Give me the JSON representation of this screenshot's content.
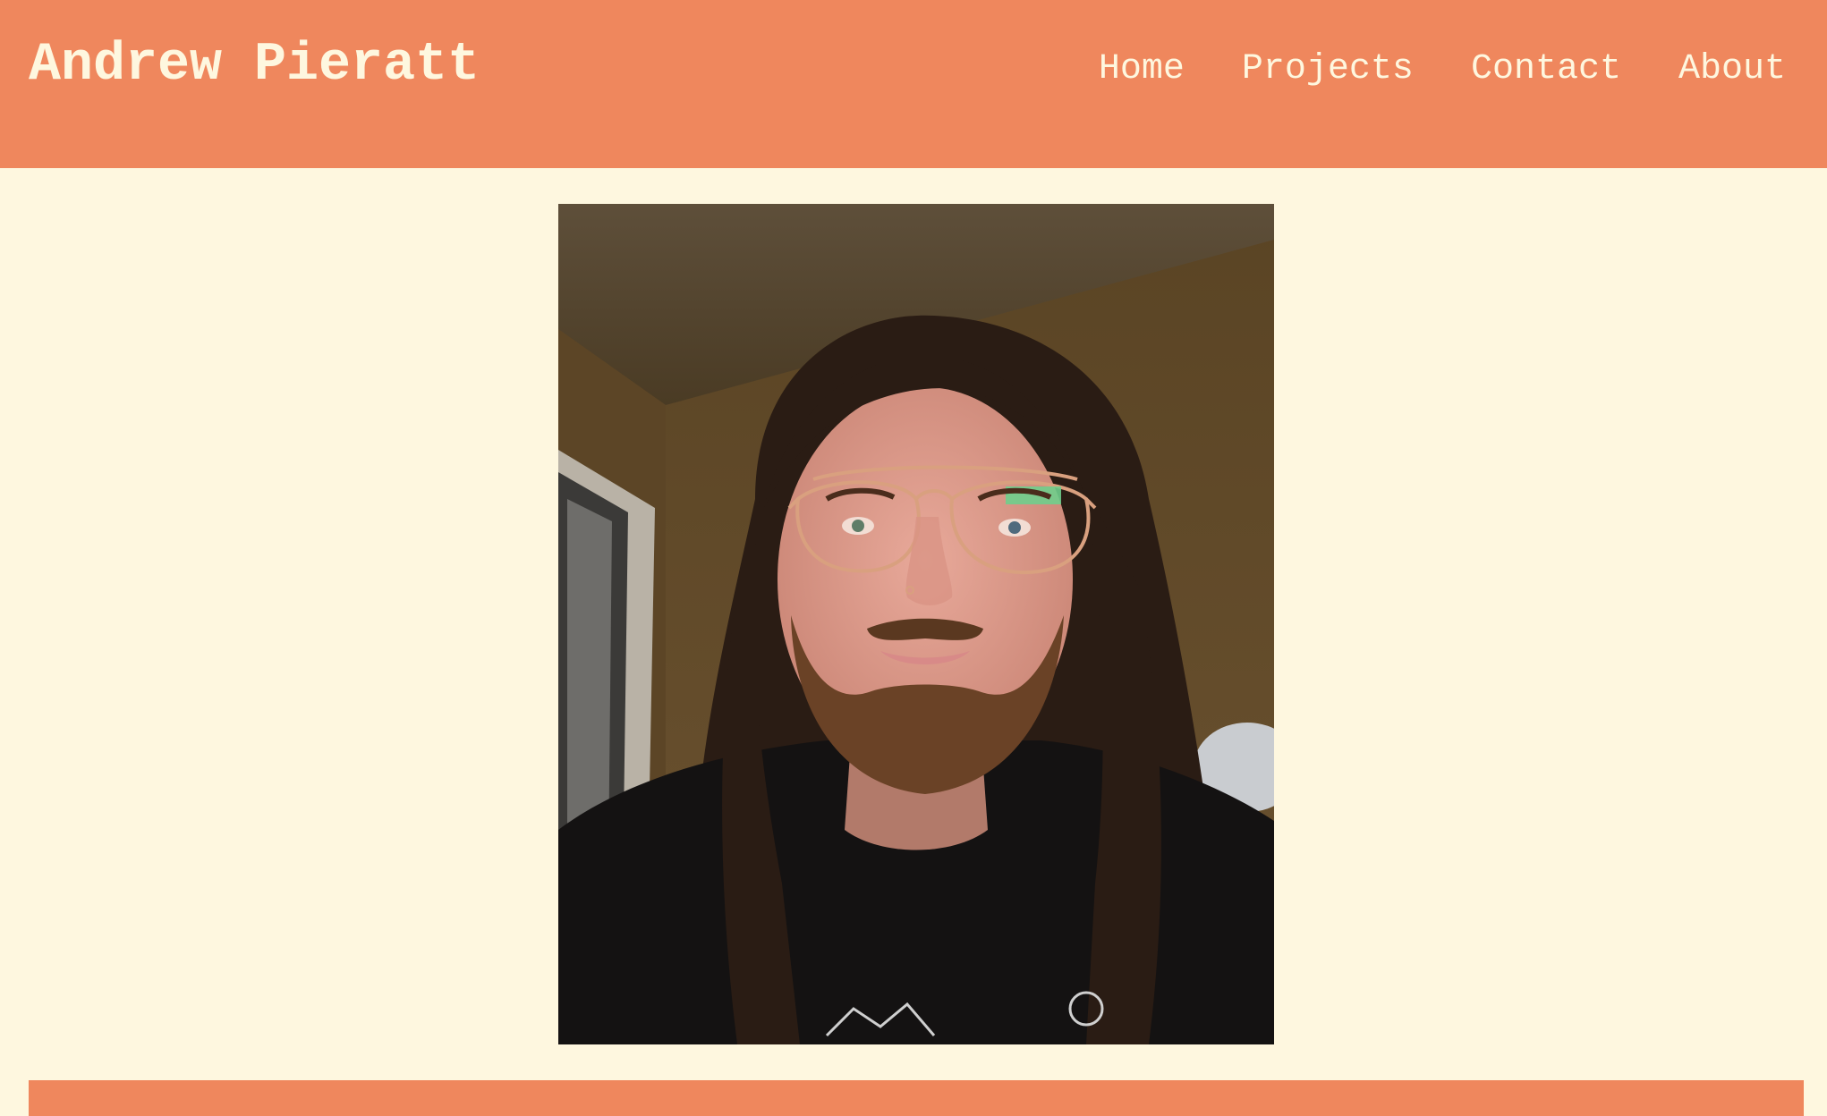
{
  "header": {
    "title": "Andrew Pieratt",
    "nav": [
      {
        "label": "Home"
      },
      {
        "label": "Projects"
      },
      {
        "label": "Contact"
      },
      {
        "label": "About"
      }
    ]
  },
  "main": {
    "photo": {
      "description_icon": "portrait-photo"
    }
  },
  "colors": {
    "accent": "#ef875d",
    "background": "#fef7df",
    "text_on_accent": "#fef7df"
  }
}
